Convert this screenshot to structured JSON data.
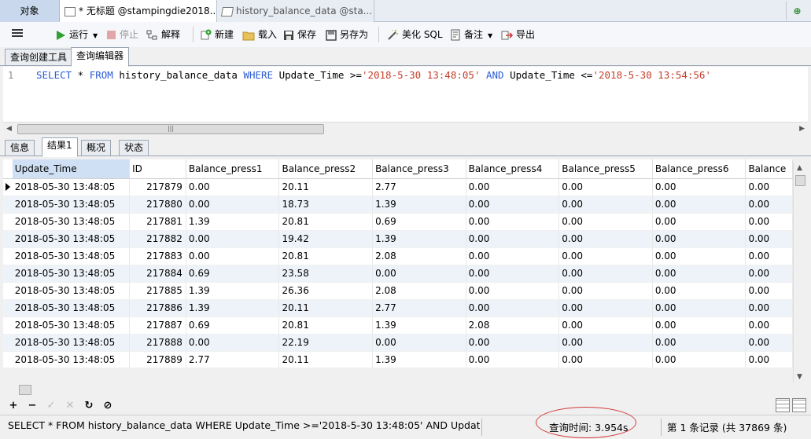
{
  "tabs": {
    "objects": "对象",
    "query1": "* 无标题 @stampingdie2018...",
    "query2": "history_balance_data @sta..."
  },
  "toolbar": {
    "run": "运行",
    "stop": "停止",
    "explain": "解释",
    "new": "新建",
    "load": "载入",
    "save": "保存",
    "save_as": "另存为",
    "beautify": "美化 SQL",
    "comment": "备注",
    "export": "导出"
  },
  "subtabs": {
    "builder": "查询创建工具",
    "editor": "查询编辑器"
  },
  "editor": {
    "line_number": "1",
    "sql": {
      "k1": "SELECT",
      "t1": " * ",
      "k2": "FROM",
      "t2": " history_balance_data ",
      "k3": "WHERE",
      "t3": " Update_Time >=",
      "s1": "'2018-5-30 13:48:05'",
      "t4": " ",
      "k4": "AND",
      "t5": " Update_Time <=",
      "s2": "'2018-5-30 13:54:56'"
    }
  },
  "result_tabs": {
    "info": "信息",
    "result": "结果1",
    "overview": "概况",
    "status": "状态"
  },
  "grid": {
    "columns": [
      "Update_Time",
      "ID",
      "Balance_press1",
      "Balance_press2",
      "Balance_press3",
      "Balance_press4",
      "Balance_press5",
      "Balance_press6",
      "Balance"
    ],
    "rows": [
      [
        "2018-05-30 13:48:05",
        "217879",
        "0.00",
        "20.11",
        "2.77",
        "0.00",
        "0.00",
        "0.00",
        "0.00"
      ],
      [
        "2018-05-30 13:48:05",
        "217880",
        "0.00",
        "18.73",
        "1.39",
        "0.00",
        "0.00",
        "0.00",
        "0.00"
      ],
      [
        "2018-05-30 13:48:05",
        "217881",
        "1.39",
        "20.81",
        "0.69",
        "0.00",
        "0.00",
        "0.00",
        "0.00"
      ],
      [
        "2018-05-30 13:48:05",
        "217882",
        "0.00",
        "19.42",
        "1.39",
        "0.00",
        "0.00",
        "0.00",
        "0.00"
      ],
      [
        "2018-05-30 13:48:05",
        "217883",
        "0.00",
        "20.81",
        "2.08",
        "0.00",
        "0.00",
        "0.00",
        "0.00"
      ],
      [
        "2018-05-30 13:48:05",
        "217884",
        "0.69",
        "23.58",
        "0.00",
        "0.00",
        "0.00",
        "0.00",
        "0.00"
      ],
      [
        "2018-05-30 13:48:05",
        "217885",
        "1.39",
        "26.36",
        "2.08",
        "0.00",
        "0.00",
        "0.00",
        "0.00"
      ],
      [
        "2018-05-30 13:48:05",
        "217886",
        "1.39",
        "20.11",
        "2.77",
        "0.00",
        "0.00",
        "0.00",
        "0.00"
      ],
      [
        "2018-05-30 13:48:05",
        "217887",
        "0.69",
        "20.81",
        "1.39",
        "2.08",
        "0.00",
        "0.00",
        "0.00"
      ],
      [
        "2018-05-30 13:48:05",
        "217888",
        "0.00",
        "22.19",
        "0.00",
        "0.00",
        "0.00",
        "0.00",
        "0.00"
      ],
      [
        "2018-05-30 13:48:05",
        "217889",
        "2.77",
        "20.11",
        "1.39",
        "0.00",
        "0.00",
        "0.00",
        "0.00"
      ]
    ]
  },
  "nav": {
    "add": "+",
    "remove": "−",
    "apply": "✓",
    "discard": "✕",
    "refresh": "↻",
    "stop": "⊘"
  },
  "status": {
    "sql": "SELECT * FROM history_balance_data WHERE Update_Time >='2018-5-30 13:48:05' AND Update_Time <",
    "query_time": "查询时间: 3.954s",
    "records": "第 1 条记录 (共 37869 条)"
  },
  "colors": {
    "keyword": "#2a5cd6",
    "string": "#c43e2a",
    "highlight": "#d23a3a"
  }
}
